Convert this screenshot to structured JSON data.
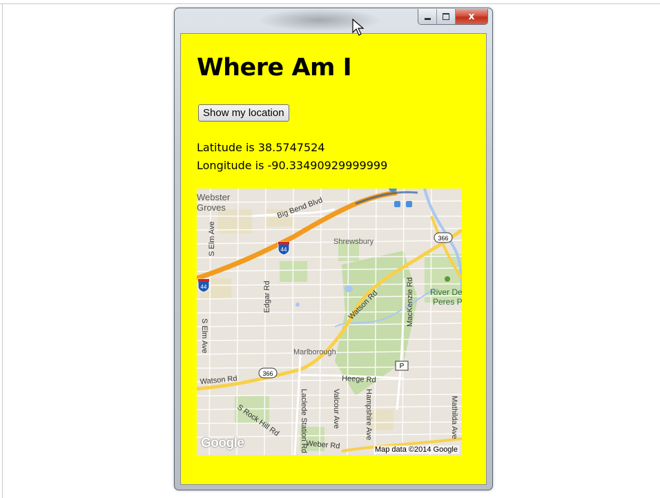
{
  "window": {
    "controls": {
      "minimize_icon": "minimize-icon",
      "maximize_icon": "maximize-icon",
      "close_label": "x"
    }
  },
  "page": {
    "title": "Where Am I",
    "button_label": "Show my location",
    "latitude_text": "Latitude is 38.5747524",
    "longitude_text": "Longitude is -90.33490929999999",
    "background_color": "#ffff00"
  },
  "map": {
    "labels": {
      "webster": "Webster",
      "groves": "Groves",
      "big_bend": "Big Bend Blvd",
      "shrewsbury": "Shrewsbury",
      "s_elm_ave_1": "S Elm Ave",
      "s_elm_ave_2": "S Elm Ave",
      "edgar_rd": "Edgar Rd",
      "watson_rd_diag": "Watson Rd",
      "watson_rd": "Watson Rd",
      "mackenzie": "MacKenzie Rd",
      "river_des_peres_1": "River De",
      "river_des_peres_2": "Peres Pa",
      "marlborough": "Marlborough",
      "heege_rd": "Heege Rd",
      "s_rock_hill": "S Rock Hill Rd",
      "laclede": "Laclede Station Rd",
      "valcour": "Valcour Ave",
      "hampshire": "Hampshire Ave",
      "mathilda": "Mathilda Ave",
      "weber_rd": "Weber Rd",
      "hwy_366_a": "366",
      "hwy_366_b": "366",
      "i44_a": "44",
      "i44_b": "44",
      "parking": "P"
    },
    "google_logo": "Google",
    "attribution": "Map data ©2014 Google"
  }
}
